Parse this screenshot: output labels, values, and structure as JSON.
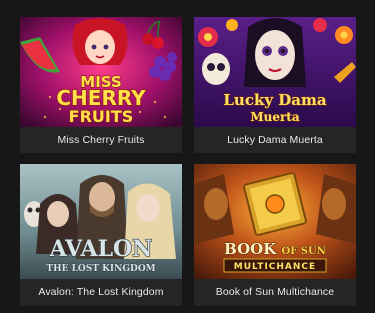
{
  "games": [
    {
      "title": "Miss Cherry Fruits",
      "logo_line1": "MISS",
      "logo_line2": "CHERRY",
      "logo_line3": "FRUITS"
    },
    {
      "title": "Lucky Dama Muerta",
      "logo_line1": "Lucky Dama",
      "logo_line2": "Muerta"
    },
    {
      "title": "Avalon: The Lost Kingdom",
      "logo_line1": "AVALON",
      "logo_line2": "THE LOST KINGDOM"
    },
    {
      "title": "Book of Sun Multichance",
      "logo_line1": "BOOK",
      "logo_line2": "OF SUN",
      "logo_line3": "MULTICHANCE"
    }
  ],
  "colors": {
    "page_bg": "#171717",
    "card_bg": "#252525",
    "caption_text": "#e9e9e9"
  }
}
